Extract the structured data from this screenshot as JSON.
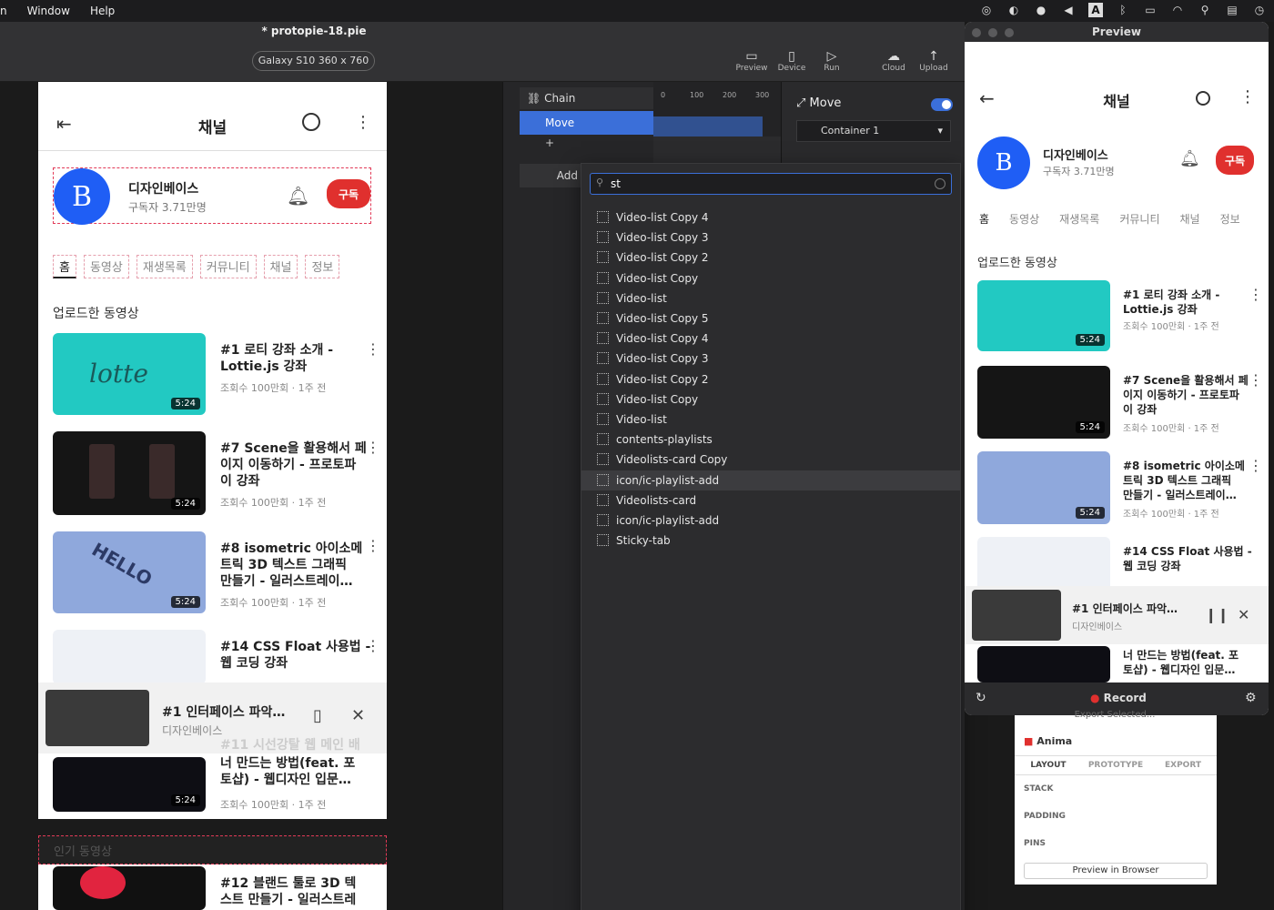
{
  "menubar": {
    "items": [
      "n",
      "Window",
      "Help"
    ]
  },
  "window": {
    "title": "* protopie-18.pie",
    "device": "Galaxy S10  360 x 760",
    "toolbar": [
      {
        "label": "Preview",
        "icon": "preview-icon"
      },
      {
        "label": "Device",
        "icon": "device-icon"
      },
      {
        "label": "Run",
        "icon": "run-icon"
      },
      {
        "label": "Cloud",
        "icon": "cloud-icon"
      },
      {
        "label": "Upload",
        "icon": "upload-icon"
      }
    ]
  },
  "phone": {
    "title": "채널",
    "channel_name": "디자인베이스",
    "subscribers": "구독자 3.71만명",
    "subscribe": "구독",
    "tabs": [
      "홈",
      "동영상",
      "재생목록",
      "커뮤니티",
      "채널",
      "정보"
    ],
    "section": "업로드한 동영상",
    "videos": [
      {
        "title1": "#1 로티 강좌 소개 -",
        "title2": "Lottie.js 강좌",
        "title3": "",
        "meta": "조회수 100만회 · 1주 전",
        "dur": "5:24"
      },
      {
        "title1": "#7 Scene을 활용해서 페",
        "title2": "이지 이동하기 - 프로토파",
        "title3": "이 강좌",
        "meta": "조회수 100만회 · 1주 전",
        "dur": "5:24"
      },
      {
        "title1": "#8 isometric 아이소메",
        "title2": "트릭 3D 텍스트 그래픽",
        "title3": "만들기 - 일러스트레이…",
        "meta": "조회수 100만회 · 1주 전",
        "dur": "5:24"
      },
      {
        "title1": "#14 CSS Float 사용법 -",
        "title2": "웹 코딩 강좌",
        "title3": "",
        "meta": "조회수 100만회 · 1주 전",
        "dur": ""
      }
    ],
    "mini_title": "#1 인터페이스 파악…",
    "mini_channel": "디자인베이스",
    "video5": {
      "title0": "#11 시선강탈 웹 메인 배",
      "title1": "너 만드는 방법(feat. 포",
      "title2": "토샵) - 웹디자인 입문…",
      "meta": "조회수 100만회 · 1주 전",
      "dur": "5:24"
    },
    "section2": "인기 동영상",
    "video6": {
      "title1": "#12 블랜드 툴로 3D 텍",
      "title2": "스트 만들기 - 일러스트레"
    }
  },
  "layers": {
    "chain": "Chain",
    "move": "Move",
    "add": "Add",
    "ticks": [
      "0",
      "100",
      "200",
      "300"
    ]
  },
  "props": {
    "title": "Move",
    "target": "Container 1",
    "toggle": true
  },
  "dropdown": {
    "query": "st",
    "items": [
      "Video-list Copy 4",
      "Video-list Copy 3",
      "Video-list Copy 2",
      "Video-list Copy",
      "Video-list",
      "Video-list Copy 5",
      "Video-list Copy 4",
      "Video-list Copy 3",
      "Video-list Copy 2",
      "Video-list Copy",
      "Video-list",
      "contents-playlists",
      "Videolists-card Copy",
      "icon/ic-playlist-add",
      "Videolists-card",
      "icon/ic-playlist-add",
      "Sticky-tab"
    ],
    "highlighted_index": 13
  },
  "preview": {
    "title": "Preview",
    "record": "Record",
    "tabs": [
      "홈",
      "동영상",
      "재생목록",
      "커뮤니티",
      "채널",
      "정보"
    ]
  },
  "anima": {
    "name": "Anima",
    "tabs": [
      "LAYOUT",
      "PROTOTYPE",
      "EXPORT"
    ],
    "rows": [
      "STACK",
      "PADDING",
      "PINS"
    ],
    "top": "Export Selected...",
    "footer": "Preview in Browser"
  },
  "colors": {
    "accent": "#1f5ef5",
    "subscribe": "#e0302e",
    "selection": "#3b6fd9"
  }
}
